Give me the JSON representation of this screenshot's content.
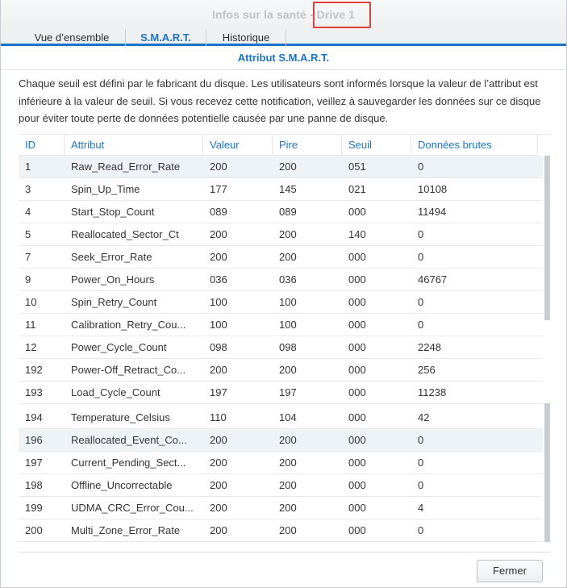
{
  "window": {
    "title": "Infos sur la santé - Drive 1"
  },
  "tabs": [
    {
      "label": "Vue d’ensemble"
    },
    {
      "label": "S.M.A.R.T."
    },
    {
      "label": "Historique"
    }
  ],
  "section": {
    "title": "Attribut S.M.A.R.T.",
    "description": "Chaque seuil est défini par le fabricant du disque. Les utilisateurs sont informés lorsque la valeur de l’attribut est inférieure à la valeur de seuil. Si vous recevez cette notification, veillez à sauvegarder les données sur ce disque pour éviter toute perte de données potentielle causée par une panne de disque."
  },
  "table": {
    "headers": [
      "ID",
      "Attribut",
      "Valeur",
      "Pire",
      "Seuil",
      "Données brutes"
    ],
    "rows": [
      [
        "1",
        "Raw_Read_Error_Rate",
        "200",
        "200",
        "051",
        "0"
      ],
      [
        "3",
        "Spin_Up_Time",
        "177",
        "145",
        "021",
        "10108"
      ],
      [
        "4",
        "Start_Stop_Count",
        "089",
        "089",
        "000",
        "11494"
      ],
      [
        "5",
        "Reallocated_Sector_Ct",
        "200",
        "200",
        "140",
        "0"
      ],
      [
        "7",
        "Seek_Error_Rate",
        "200",
        "200",
        "000",
        "0"
      ],
      [
        "9",
        "Power_On_Hours",
        "036",
        "036",
        "000",
        "46767"
      ],
      [
        "10",
        "Spin_Retry_Count",
        "100",
        "100",
        "000",
        "0"
      ],
      [
        "11",
        "Calibration_Retry_Cou...",
        "100",
        "100",
        "000",
        "0"
      ],
      [
        "12",
        "Power_Cycle_Count",
        "098",
        "098",
        "000",
        "2248"
      ],
      [
        "192",
        "Power-Off_Retract_Co...",
        "200",
        "200",
        "000",
        "256"
      ],
      [
        "193",
        "Load_Cycle_Count",
        "197",
        "197",
        "000",
        "11238"
      ],
      [
        "194",
        "Temperature_Celsius",
        "110",
        "104",
        "000",
        "42"
      ],
      [
        "196",
        "Reallocated_Event_Co...",
        "200",
        "200",
        "000",
        "0"
      ],
      [
        "197",
        "Current_Pending_Sect...",
        "200",
        "200",
        "000",
        "0"
      ],
      [
        "198",
        "Offline_Uncorrectable",
        "200",
        "200",
        "000",
        "0"
      ],
      [
        "199",
        "UDMA_CRC_Error_Cou...",
        "200",
        "200",
        "000",
        "4"
      ],
      [
        "200",
        "Multi_Zone_Error_Rate",
        "200",
        "200",
        "000",
        "0"
      ]
    ]
  },
  "footer": {
    "close_label": "Fermer"
  },
  "colors": {
    "accent": "#1a73c6",
    "highlight": "#e0413c",
    "row_alt": "#eef3f8"
  }
}
